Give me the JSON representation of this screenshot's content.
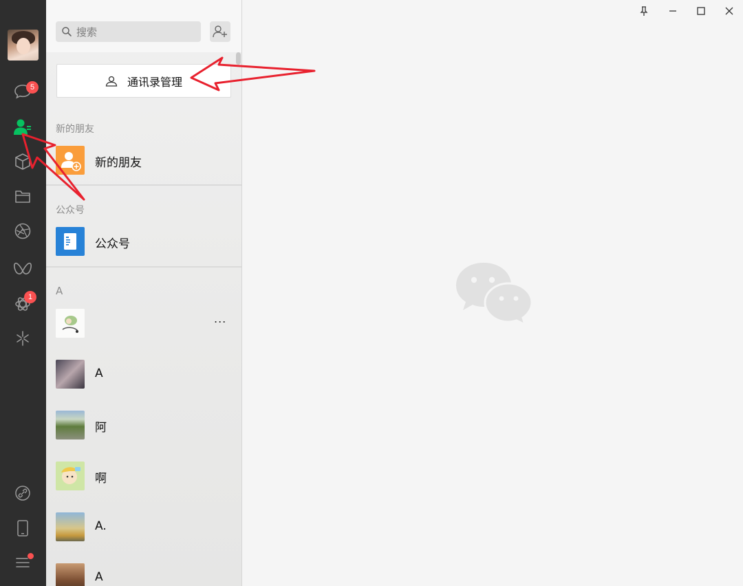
{
  "nav": {
    "chat_badge": "5",
    "moments_badge": "1",
    "items": [
      "chat-icon",
      "contacts-icon",
      "favorites-icon",
      "files-icon",
      "moments-icon",
      "channels-icon",
      "mini-programs-icon",
      "search-discover-icon",
      "link-icon",
      "phone-icon",
      "menu-icon"
    ],
    "active": "contacts-icon",
    "accent": "#07c160"
  },
  "search": {
    "placeholder": "搜索"
  },
  "contacts": {
    "manage_label": "通讯录管理",
    "sections": [
      {
        "title": "新的朋友",
        "items": [
          {
            "name": "新的朋友",
            "icon": "new-friend-icon",
            "color": "#fa9d3b"
          }
        ]
      },
      {
        "title": "公众号",
        "items": [
          {
            "name": "公众号",
            "icon": "official-account-icon",
            "color": "#2782d7"
          }
        ]
      },
      {
        "title": "A",
        "items": [
          {
            "name": "",
            "extra": "..."
          },
          {
            "name": "A"
          },
          {
            "name": "阿"
          },
          {
            "name": "啊"
          },
          {
            "name": "A."
          },
          {
            "name": "A"
          }
        ]
      }
    ]
  },
  "window_controls": [
    "pin-icon",
    "minimize-icon",
    "maximize-icon",
    "close-icon"
  ],
  "colors": {
    "sidebar": "#2e2e2e",
    "badge": "#fa5151",
    "annotation": "#e8212e"
  }
}
